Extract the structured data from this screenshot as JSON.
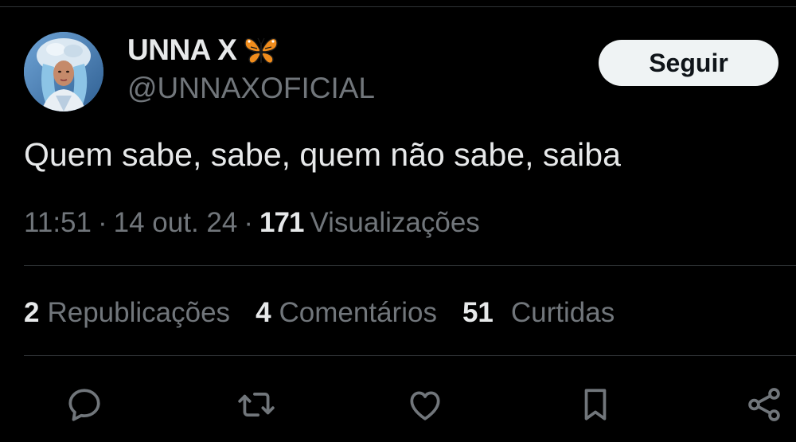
{
  "author": {
    "display_name": "UNNA X",
    "handle": "@UNNAXOFICIAL",
    "badge_icon": "butterfly-icon",
    "follow_label": "Seguir"
  },
  "tweet": {
    "text": "Quem sabe, sabe, quem não sabe, saiba",
    "time": "11:51",
    "date": "14 out. 24",
    "views_count": "171",
    "views_label": "Visualizações"
  },
  "stats": {
    "reposts_count": "2",
    "reposts_label": "Republicações",
    "comments_count": "4",
    "comments_label": "Comentários",
    "likes_count": "51",
    "likes_label": "Curtidas"
  },
  "actions": [
    "reply-icon",
    "repost-icon",
    "like-icon",
    "bookmark-icon",
    "share-icon"
  ],
  "colors": {
    "background": "#000000",
    "primary_text": "#e7e9ea",
    "secondary_text": "#71767b",
    "divider": "#2f3336",
    "button_bg": "#eff3f4",
    "butterfly": "#f08c1c"
  }
}
